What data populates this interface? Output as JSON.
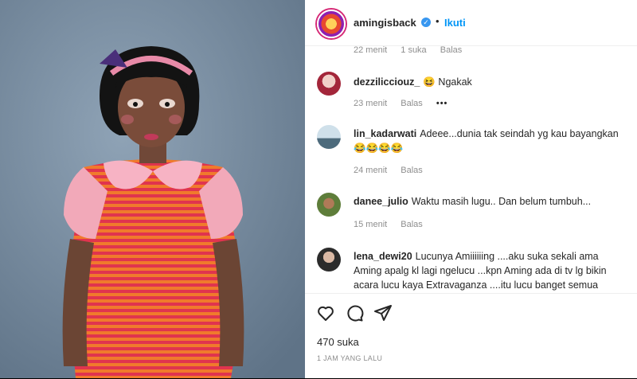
{
  "post": {
    "username": "amingisback",
    "separator": "•",
    "follow_label": "Ikuti",
    "verified_mark": "✓"
  },
  "top_comment_meta": {
    "time": "22 menit",
    "likes": "1 suka",
    "reply": "Balas"
  },
  "comments": [
    {
      "user": "dezzilicciouz_",
      "emoji": "😆",
      "text": "Ngakak",
      "time": "23 menit",
      "reply": "Balas",
      "more": "•••"
    },
    {
      "user": "lin_kadarwati",
      "text": "Adeee...dunia tak seindah yg kau bayangkan😂😂😂😂",
      "time": "24 menit",
      "reply": "Balas"
    },
    {
      "user": "danee_julio",
      "text": "Waktu masih lugu.. Dan belum tumbuh...",
      "time": "15 menit",
      "reply": "Balas"
    },
    {
      "user": "lena_dewi20",
      "text": "Lucunya Amiiiiiing ....aku suka sekali ama Aming apalg kl lagi ngelucu ...kpn Aming ada di tv lg bikin acara lucu kaya Extravaganza ....itu lucu banget semua pemain nyaa"
    }
  ],
  "actions": {
    "like_icon": "heart-icon",
    "comment_icon": "comment-icon",
    "share_icon": "send-icon"
  },
  "likes_text": "470 suka",
  "time_ago": "1 JAM YANG LALU",
  "colors": {
    "accent": "#0095f6",
    "verified": "#3897f0",
    "muted": "#8e8e8e"
  }
}
